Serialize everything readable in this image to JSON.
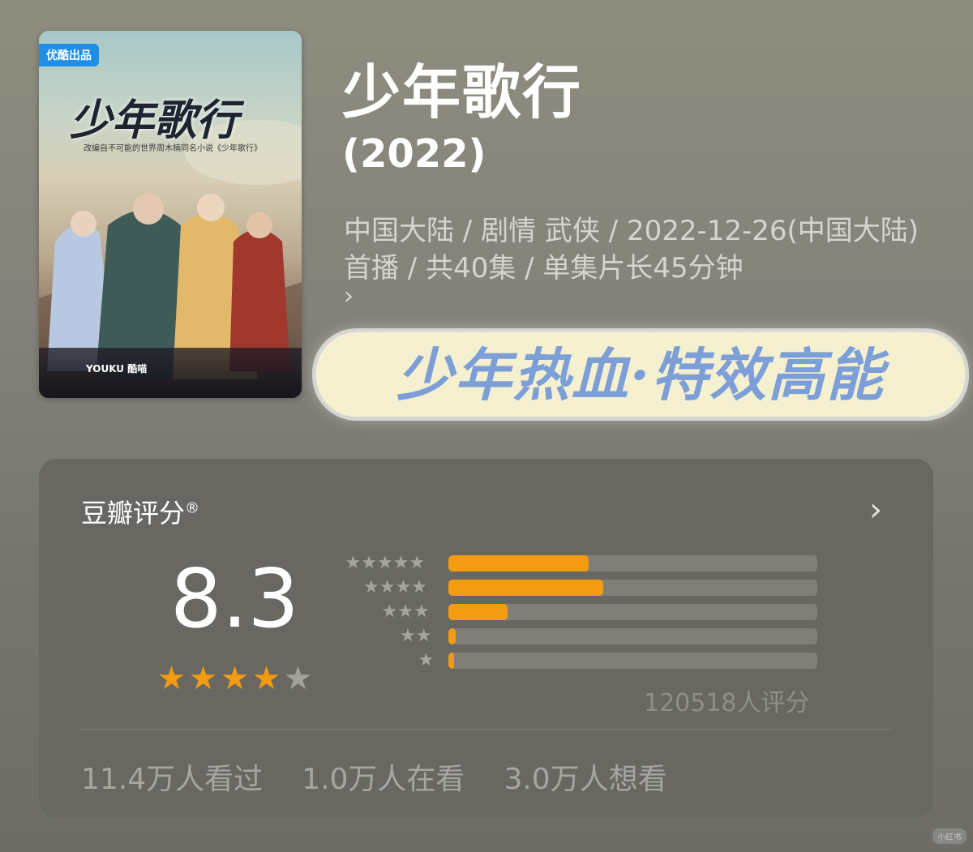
{
  "poster": {
    "badge": "优酷出品",
    "title": "少年歌行",
    "tagline": "改编自不可能的世界周木楠同名小说《少年歌行》",
    "footer": "YOUKU  酷喵"
  },
  "show": {
    "title": "少年歌行",
    "year": "(2022)",
    "meta": "中国大陆 / 剧情 武侠 / 2022-12-26(中国大陆)首播 / 共40集 / 单集片长45分钟",
    "more": "›"
  },
  "banner": {
    "text": "少年热血·特效高能"
  },
  "rating": {
    "title": "豆瓣评分",
    "registered": "®",
    "arrow": "›",
    "score": "8.3",
    "stars_filled": 4,
    "stars_total": 5,
    "distribution": [
      {
        "stars": 5,
        "fraction": 0.38
      },
      {
        "stars": 4,
        "fraction": 0.42
      },
      {
        "stars": 3,
        "fraction": 0.16
      },
      {
        "stars": 2,
        "fraction": 0.02
      },
      {
        "stars": 1,
        "fraction": 0.01
      }
    ],
    "votes": "120518人评分"
  },
  "stats": {
    "watched": "11.4万人看过",
    "watching": "1.0万人在看",
    "want": "3.0万人想看"
  },
  "watermark": "小红书",
  "colors": {
    "accent": "#f39c12",
    "banner_text": "#7d9fd8",
    "badge": "#1e8ee6"
  }
}
